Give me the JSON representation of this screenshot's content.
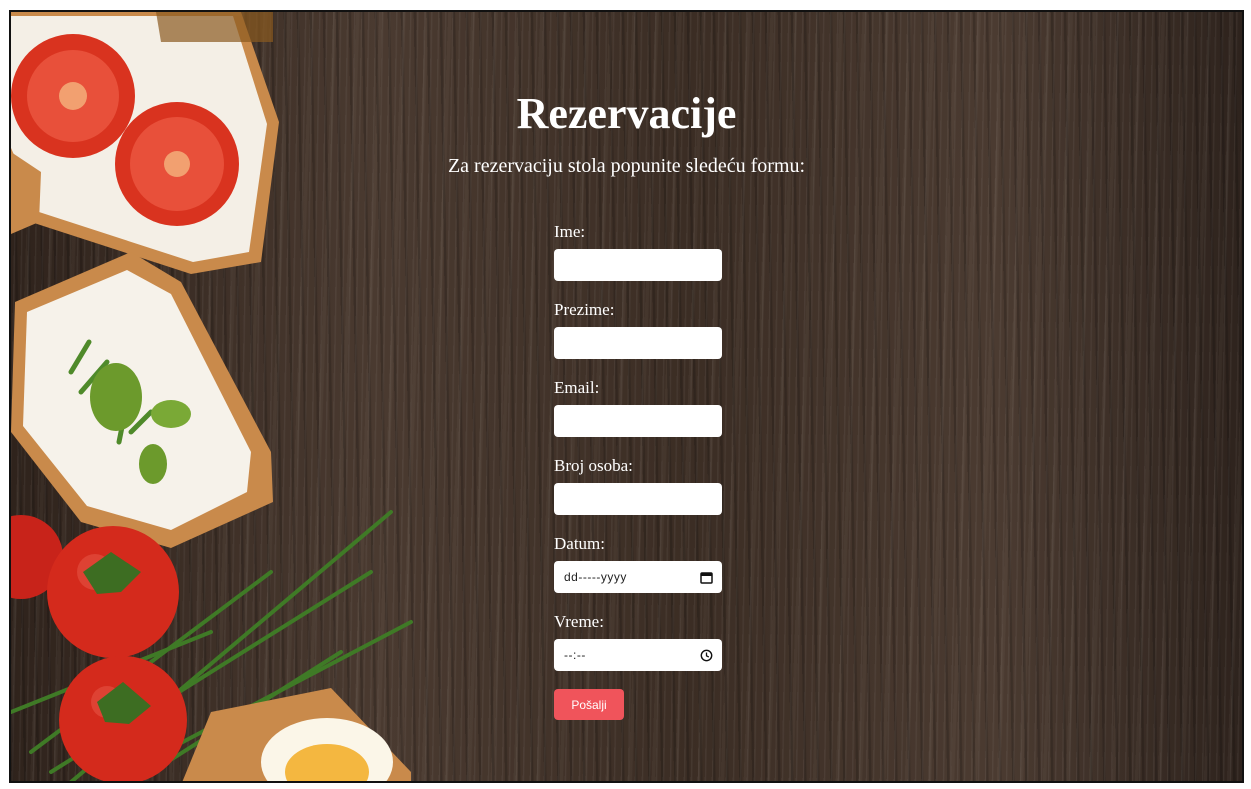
{
  "page": {
    "title": "Rezervacije",
    "subtitle": "Za rezervaciju stola popunite sledeću formu:"
  },
  "form": {
    "fields": [
      {
        "label": "Ime:",
        "type": "text",
        "value": ""
      },
      {
        "label": "Prezime:",
        "type": "text",
        "value": ""
      },
      {
        "label": "Email:",
        "type": "email",
        "value": ""
      },
      {
        "label": "Broj osoba:",
        "type": "number",
        "value": ""
      },
      {
        "label": "Datum:",
        "type": "date",
        "placeholder": "dd-----yyyy",
        "icon": "calendar-icon"
      },
      {
        "label": "Vreme:",
        "type": "time",
        "placeholder": "--:--",
        "icon": "clock-icon"
      }
    ],
    "submit_label": "Pošalji"
  },
  "colors": {
    "background_wood": "#3a2c23",
    "submit_button": "#f0545b",
    "text": "#ffffff"
  }
}
